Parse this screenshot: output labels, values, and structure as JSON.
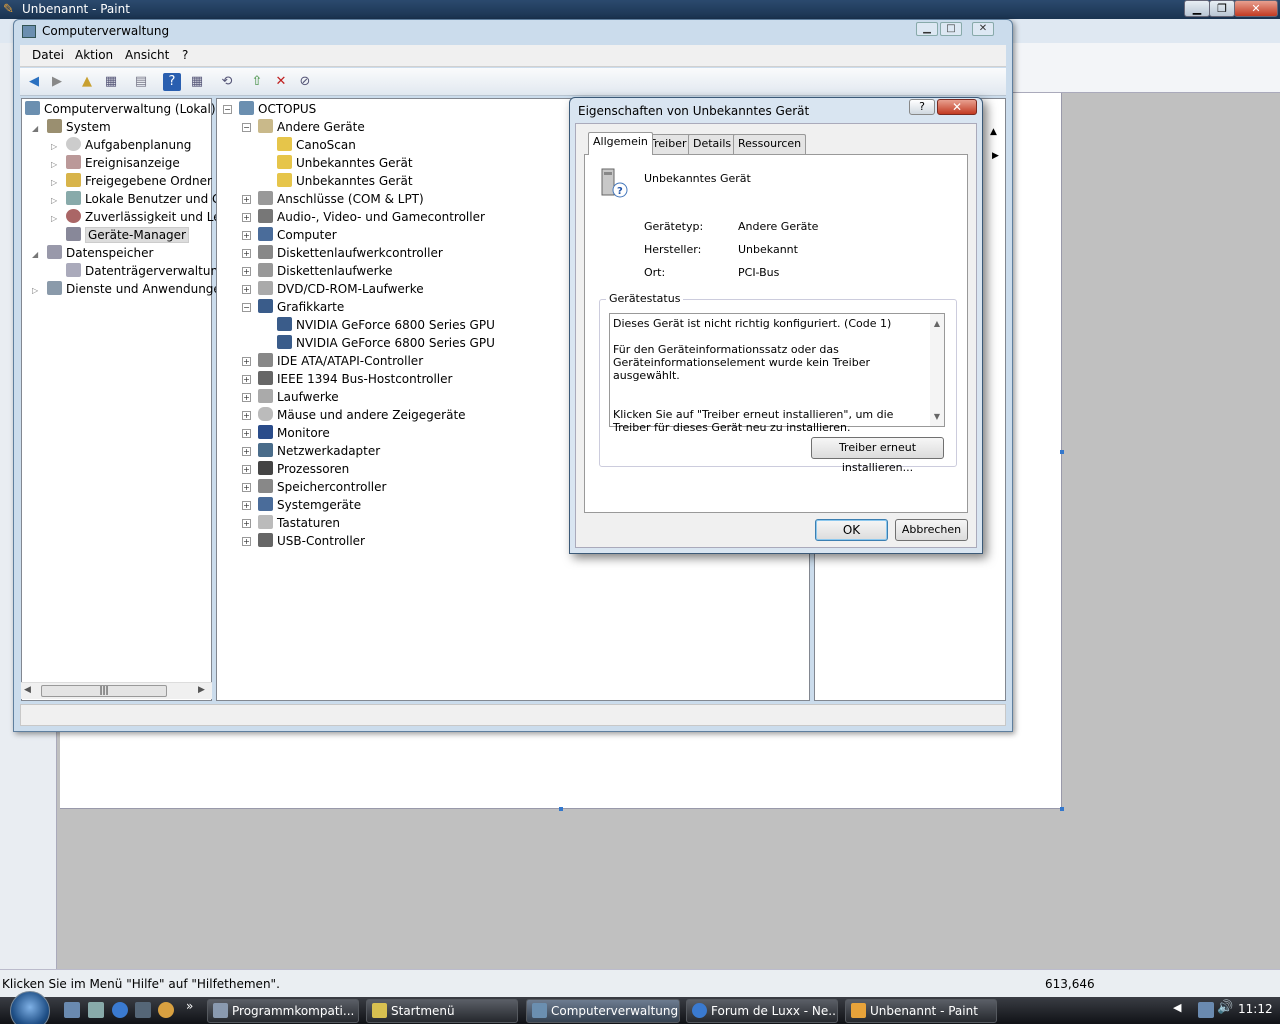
{
  "paint": {
    "title": "Unbenannt - Paint",
    "status_text": "Klicken Sie im Menü \"Hilfe\" auf \"Hilfethemen\".",
    "coords": "613,646"
  },
  "cv": {
    "title": "Computerverwaltung",
    "menu": [
      "Datei",
      "Aktion",
      "Ansicht",
      "?"
    ],
    "left_tree": [
      "Computerverwaltung (Lokal)",
      "System",
      "Aufgabenplanung",
      "Ereignisanzeige",
      "Freigegebene Ordner",
      "Lokale Benutzer und Gr",
      "Zuverlässigkeit und Leis",
      "Geräte-Manager",
      "Datenspeicher",
      "Datenträgerverwaltung",
      "Dienste und Anwendungen"
    ],
    "device_tree": [
      "OCTOPUS",
      "Andere Geräte",
      "CanoScan",
      "Unbekanntes Gerät",
      "Unbekanntes Gerät",
      "Anschlüsse (COM & LPT)",
      "Audio-, Video- und Gamecontroller",
      "Computer",
      "Diskettenlaufwerkcontroller",
      "Diskettenlaufwerke",
      "DVD/CD-ROM-Laufwerke",
      "Grafikkarte",
      "NVIDIA GeForce 6800 Series GPU",
      "NVIDIA GeForce 6800 Series GPU",
      "IDE ATA/ATAPI-Controller",
      "IEEE 1394 Bus-Hostcontroller",
      "Laufwerke",
      "Mäuse und andere Zeigegeräte",
      "Monitore",
      "Netzwerkadapter",
      "Prozessoren",
      "Speichercontroller",
      "Systemgeräte",
      "Tastaturen",
      "USB-Controller"
    ]
  },
  "dialog": {
    "title": "Eigenschaften von Unbekanntes Gerät",
    "help": "?",
    "close": "✕",
    "tabs": [
      "Allgemein",
      "Treiber",
      "Details",
      "Ressourcen"
    ],
    "device_name": "Unbekanntes Gerät",
    "props": [
      {
        "label": "Gerätetyp:",
        "value": "Andere Geräte"
      },
      {
        "label": "Hersteller:",
        "value": "Unbekannt"
      },
      {
        "label": "Ort:",
        "value": "PCI-Bus"
      }
    ],
    "status_legend": "Gerätestatus",
    "status_lines": [
      "Dieses Gerät ist nicht richtig konfiguriert. (Code 1)",
      "Für den Geräteinformationssatz oder das Geräteinformationselement wurde kein Treiber ausgewählt.",
      "Klicken Sie auf \"Treiber erneut installieren\", um die Treiber für dieses Gerät neu zu installieren."
    ],
    "reinstall_button": "Treiber erneut installieren...",
    "ok_button": "OK",
    "cancel_button": "Abbrechen"
  },
  "taskbar": {
    "tasks": [
      "Programmkompati...",
      "Startmenü",
      "Computerverwaltung",
      "Forum de Luxx - Ne...",
      "Unbenannt - Paint"
    ],
    "time": "11:12"
  },
  "colors": {
    "accent": "#2b4a6e",
    "window_frame": "#cbdcec",
    "close_red": "#c23a22"
  }
}
